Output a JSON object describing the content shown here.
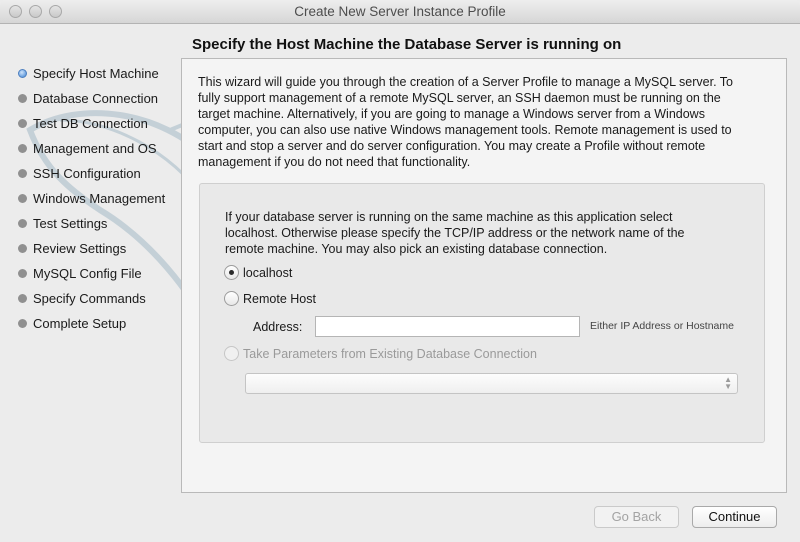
{
  "window": {
    "title": "Create New Server Instance Profile"
  },
  "page": {
    "heading": "Specify the Host Machine the Database Server is running on"
  },
  "steps": [
    {
      "label": "Specify Host Machine",
      "active": true
    },
    {
      "label": "Database Connection",
      "active": false
    },
    {
      "label": "Test DB Connection",
      "active": false
    },
    {
      "label": "Management and OS",
      "active": false
    },
    {
      "label": "SSH Configuration",
      "active": false
    },
    {
      "label": "Windows Management",
      "active": false
    },
    {
      "label": "Test Settings",
      "active": false
    },
    {
      "label": "Review Settings",
      "active": false
    },
    {
      "label": "MySQL Config File",
      "active": false
    },
    {
      "label": "Specify Commands",
      "active": false
    },
    {
      "label": "Complete Setup",
      "active": false
    }
  ],
  "intro": {
    "lines": [
      "This wizard will guide you through the creation of a Server Profile to manage a MySQL server. To",
      "fully support management of a remote MySQL server, an SSH daemon must be running on the",
      "target machine. Alternatively, if you are going to manage a Windows server from a Windows",
      "computer, you can also use native Windows management tools. Remote management is used to",
      "start and stop a server and do server configuration. You may create a Profile without remote",
      "management if you do not need that functionality."
    ]
  },
  "host": {
    "description_lines": [
      "If your database server is running on the same machine as this application select",
      "localhost. Otherwise please specify the TCP/IP address or the network name of the",
      "remote machine. You may also pick an existing database connection."
    ],
    "option_localhost": "localhost",
    "option_remote": "Remote Host",
    "address_label": "Address:",
    "address_value": "",
    "address_hint": "Either IP Address or Hostname",
    "option_existing": "Take Parameters from Existing Database Connection",
    "connection_selected": ""
  },
  "buttons": {
    "back": "Go Back",
    "continue": "Continue"
  }
}
